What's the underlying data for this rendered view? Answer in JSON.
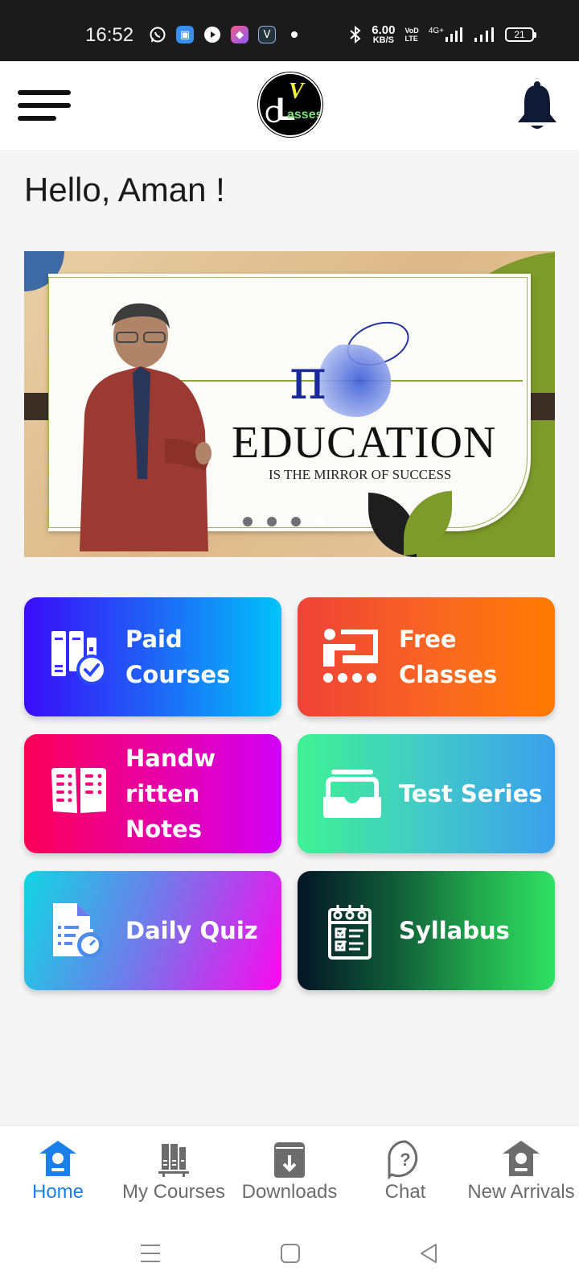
{
  "status_bar": {
    "time": "16:52",
    "notification_icons": [
      "whatsapp-icon",
      "messages-icon",
      "play-icon",
      "shortcut-icon",
      "vpn-app-icon",
      "dot-icon"
    ],
    "network_speed_value": "6.00",
    "network_speed_unit": "KB/S",
    "volte_top": "VoD",
    "volte_bottom": "LTE",
    "network_type": "4G+",
    "battery_level": "21"
  },
  "app_bar": {
    "logo_text_v": "V",
    "logo_text_c": "C",
    "logo_text_l": "L",
    "logo_text_asses": "asses"
  },
  "greeting": "Hello, Aman !",
  "banner": {
    "headline": "EDUCATION",
    "tagline": "IS THE MIRROR OF SUCCESS",
    "pi_symbol": "π",
    "slide_count": 4,
    "active_slide": 4
  },
  "tiles": [
    {
      "label": "Paid Courses",
      "icon": "books-check-icon"
    },
    {
      "label": "Free Classes",
      "icon": "classroom-icon"
    },
    {
      "label": "Handw ritten Notes",
      "icon": "notebook-icon"
    },
    {
      "label": "Test Series",
      "icon": "tray-icon"
    },
    {
      "label": "Daily Quiz",
      "icon": "quiz-timer-icon"
    },
    {
      "label": "Syllabus",
      "icon": "checklist-icon"
    }
  ],
  "bottom_nav": {
    "items": [
      {
        "label": "Home",
        "icon": "home-icon",
        "active": true
      },
      {
        "label": "My Courses",
        "icon": "bookshelf-icon",
        "active": false
      },
      {
        "label": "Downloads",
        "icon": "download-box-icon",
        "active": false
      },
      {
        "label": "Chat",
        "icon": "help-chat-icon",
        "active": false
      },
      {
        "label": "New Arrivals",
        "icon": "new-arrivals-icon",
        "active": false
      }
    ],
    "active_color": "#1a7fe8",
    "inactive_color": "#6c6c6c"
  },
  "system_nav": [
    "recents-button",
    "home-button",
    "back-button"
  ]
}
